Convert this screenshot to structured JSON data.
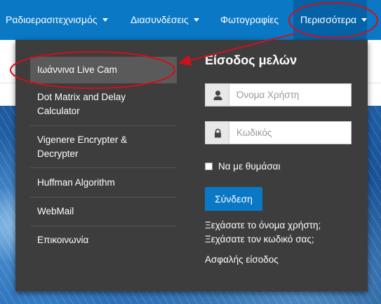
{
  "nav": {
    "items": [
      {
        "label": "Ραδιοερασιτεχνισμός"
      },
      {
        "label": "Διασυνδέσεις"
      },
      {
        "label": "Φωτογραφίες"
      },
      {
        "label": "Περισσότερα"
      }
    ]
  },
  "dropdown": {
    "menu": [
      {
        "label": "Ιωάννινα Live Cam"
      },
      {
        "label_line1": "Dot Matrix and Delay",
        "label_line2": "Calculator"
      },
      {
        "label_line1": "Vigenere Encrypter &",
        "label_line2": "Decrypter"
      },
      {
        "label": "Huffman Algorithm"
      },
      {
        "label": "WebMail"
      },
      {
        "label": "Επικοινωνία"
      }
    ],
    "login": {
      "title": "Είσοδος μελών",
      "username_placeholder": "Όνομα Χρήστη",
      "password_placeholder": "Κωδικός",
      "remember_label": "Να με θυμάσαι",
      "submit_label": "Σύνδεση",
      "forgot_username": "Ξεχάσατε το όνομα χρήστη;",
      "forgot_password": "Ξεχάσατε τον κωδικό σας;",
      "secure_login": "Ασφαλής είσοδος"
    }
  },
  "colors": {
    "nav_blue": "#0a78c4",
    "panel_gray": "#3d3d3d",
    "annotation_red": "#d0101a"
  }
}
